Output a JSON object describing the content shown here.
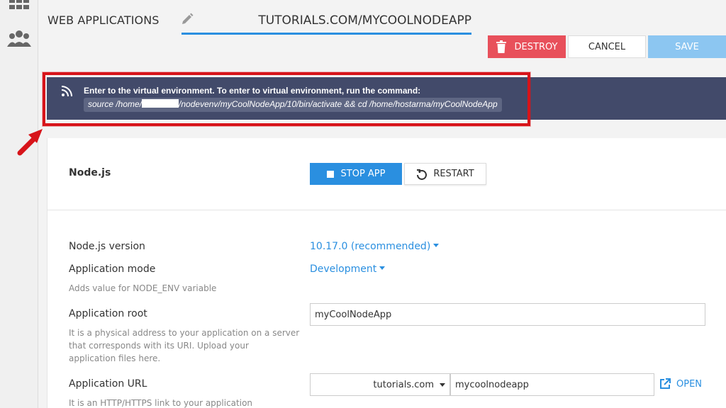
{
  "header": {
    "breadcrumb": "WEB APPLICATIONS",
    "domain_path": "TUTORIALS.COM/MYCOOLNODEAPP",
    "destroy_label": "DESTROY",
    "cancel_label": "CANCEL",
    "save_label": "SAVE"
  },
  "notice": {
    "message": "Enter to the virtual environment. To enter to virtual environment, run the command:",
    "command_prefix": "source /home/",
    "command_suffix": "/nodevenv/myCoolNodeApp/10/bin/activate && cd /home/hostarma/myCoolNodeApp"
  },
  "app": {
    "section_title": "Node.js",
    "stop_label": "STOP APP",
    "restart_label": "RESTART",
    "fields": {
      "version_label": "Node.js version",
      "version_value": "10.17.0 (recommended)",
      "mode_label": "Application mode",
      "mode_value": "Development",
      "mode_hint": "Adds value for NODE_ENV variable",
      "root_label": "Application root",
      "root_value": "myCoolNodeApp",
      "root_hint_1": "It is a physical address to your application on a server",
      "root_hint_2": "that corresponds with its URI. Upload your",
      "root_hint_3": "application files here.",
      "url_label": "Application URL",
      "url_domain": "tutorials.com",
      "url_path": "mycoolnodeapp",
      "url_hint": "It is an HTTP/HTTPS link to your application",
      "open_label": "OPEN"
    }
  },
  "colors": {
    "accent": "#2a8fe0",
    "danger": "#e8505b",
    "notice_bg": "#424a6a",
    "highlight": "#d7141a"
  }
}
